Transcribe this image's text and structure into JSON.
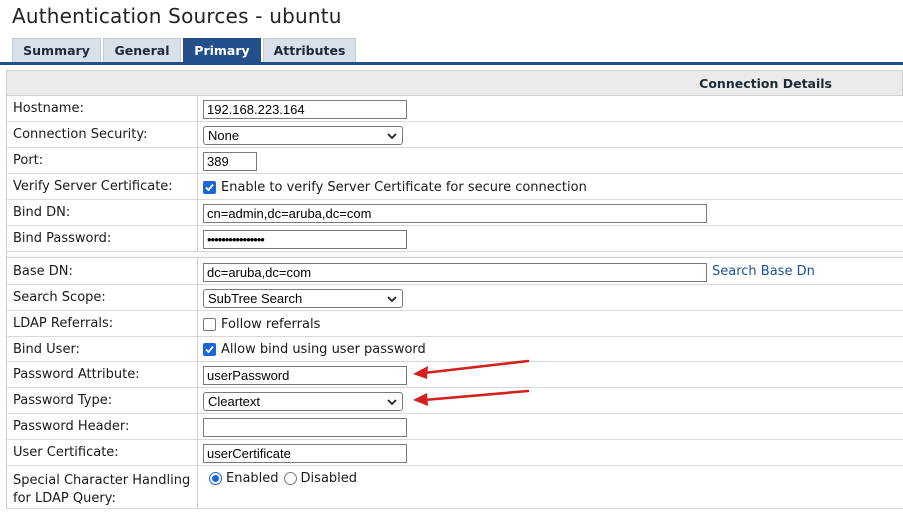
{
  "page": {
    "title": "Authentication Sources - ubuntu"
  },
  "tabs": [
    {
      "label": "Summary",
      "active": false
    },
    {
      "label": "General",
      "active": false
    },
    {
      "label": "Primary",
      "active": true
    },
    {
      "label": "Attributes",
      "active": false
    }
  ],
  "section": {
    "title": "Connection Details"
  },
  "fields": {
    "hostname": {
      "label": "Hostname:",
      "value": "192.168.223.164"
    },
    "connection_security": {
      "label": "Connection Security:",
      "value": "None"
    },
    "port": {
      "label": "Port:",
      "value": "389"
    },
    "verify_cert": {
      "label": "Verify Server Certificate:",
      "checked": true,
      "text": "Enable to verify Server Certificate for secure connection"
    },
    "bind_dn": {
      "label": "Bind DN:",
      "value": "cn=admin,dc=aruba,dc=com"
    },
    "bind_password": {
      "label": "Bind Password:",
      "value": "••••••••••••••••"
    },
    "base_dn": {
      "label": "Base DN:",
      "value": "dc=aruba,dc=com",
      "link": "Search Base Dn"
    },
    "search_scope": {
      "label": "Search Scope:",
      "value": "SubTree Search"
    },
    "ldap_referrals": {
      "label": "LDAP Referrals:",
      "checked": false,
      "text": "Follow referrals"
    },
    "bind_user": {
      "label": "Bind User:",
      "checked": true,
      "text": "Allow bind using user password"
    },
    "password_attribute": {
      "label": "Password Attribute:",
      "value": "userPassword"
    },
    "password_type": {
      "label": "Password Type:",
      "value": "Cleartext"
    },
    "password_header": {
      "label": "Password Header:",
      "value": ""
    },
    "user_certificate": {
      "label": "User Certificate:",
      "value": "userCertificate"
    },
    "special_char": {
      "label": "Special Character Handling for LDAP Query:",
      "options": [
        {
          "label": "Enabled",
          "selected": true
        },
        {
          "label": "Disabled",
          "selected": false
        }
      ]
    }
  },
  "colors": {
    "tab_active": "#23508a",
    "link": "#1e4f9c",
    "checkbox": "#1a66d8",
    "annotation_arrow": "#d42020"
  },
  "icons": {
    "select": "chevron-down-icon",
    "check": "checkmark-icon",
    "annotation": "red-arrow-icon"
  }
}
